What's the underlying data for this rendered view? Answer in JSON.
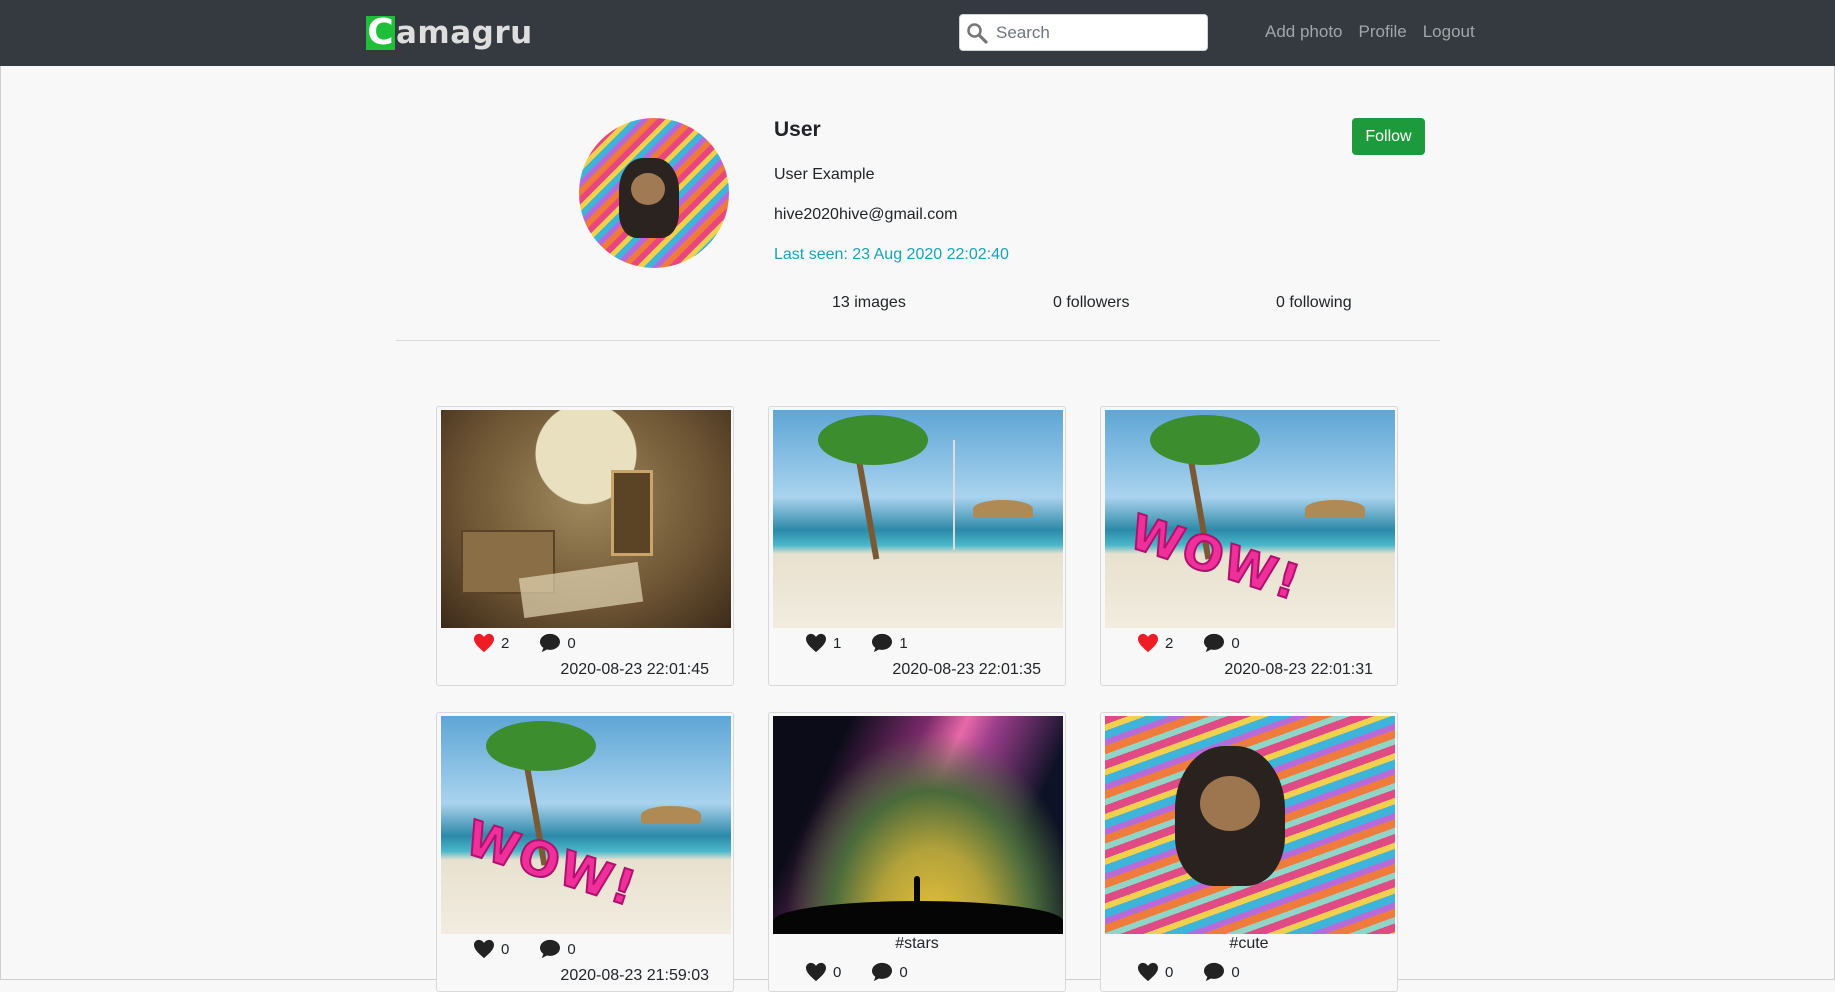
{
  "nav": {
    "logo_letter": "C",
    "logo_text": "amagru",
    "search_placeholder": "Search",
    "links": [
      "Add photo",
      "Profile",
      "Logout"
    ]
  },
  "profile": {
    "username": "User",
    "full_name": "User Example",
    "email": "hive2020hive@gmail.com",
    "last_seen": "Last seen: 23 Aug 2020 22:02:40",
    "follow_label": "Follow",
    "stats": {
      "images": "13 images",
      "followers": "0 followers",
      "following": "0 following"
    }
  },
  "posts": [
    {
      "image": "globe-desk",
      "liked": true,
      "likes": "2",
      "comments": "0",
      "date": "2020-08-23 22:01:45",
      "tag": ""
    },
    {
      "image": "beach",
      "liked": false,
      "likes": "1",
      "comments": "1",
      "date": "2020-08-23 22:01:35",
      "tag": ""
    },
    {
      "image": "beach-wow",
      "sticker": "WOW!",
      "liked": true,
      "likes": "2",
      "comments": "0",
      "date": "2020-08-23 22:01:31",
      "tag": ""
    },
    {
      "image": "beach-wow",
      "sticker": "WOW!",
      "liked": false,
      "likes": "0",
      "comments": "0",
      "date": "2020-08-23 21:59:03",
      "tag": ""
    },
    {
      "image": "stars",
      "liked": false,
      "likes": "0",
      "comments": "0",
      "date": "",
      "tag": "#stars"
    },
    {
      "image": "puppy",
      "liked": false,
      "likes": "0",
      "comments": "0",
      "date": "",
      "tag": "#cute"
    }
  ],
  "colors": {
    "navbar": "#343a40",
    "follow": "#1d9b3c",
    "link_teal": "#17a2b8",
    "heart_liked": "#ee1c25"
  },
  "icons": [
    "search-icon",
    "heart-icon",
    "comment-icon"
  ]
}
